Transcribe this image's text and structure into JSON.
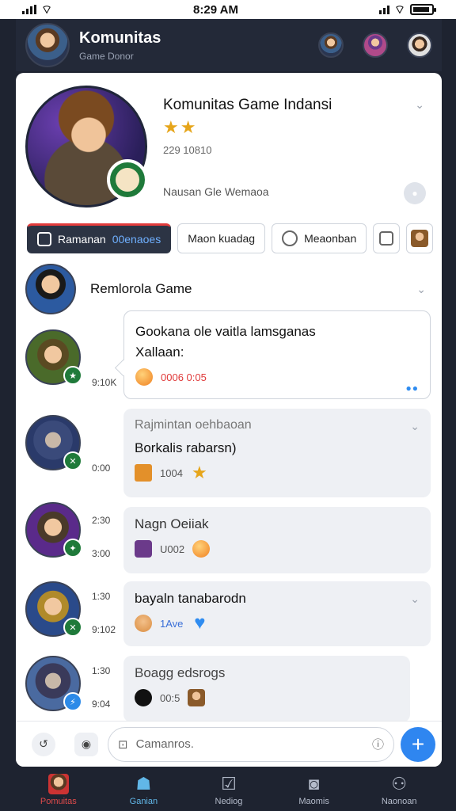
{
  "status_bar": {
    "time": "8:29 AM"
  },
  "header": {
    "title": "Komunitas",
    "subtitle": "Game Donor"
  },
  "profile": {
    "name": "Komunitas Game Indansi",
    "stars": "★★",
    "count": "229 10810",
    "status": "Nausan Gle Wemaoa"
  },
  "tabs": [
    {
      "label": "Ramanan",
      "accent": "00enaoes"
    },
    {
      "label": "Maon kuadag"
    },
    {
      "label": "Meaonban"
    }
  ],
  "section": {
    "title": "Remlorola Game"
  },
  "messages": [
    {
      "time": "9:10K",
      "text1": "Gookana ole vaitla lamsganas",
      "text2": "Xallaan:",
      "count": "0006 0:05"
    },
    {
      "time": "0:00",
      "head": "Rajmintan oehbaoan",
      "text": "Borkalis rabarsn)",
      "count": "1004"
    },
    {
      "time1": "2:30",
      "time2": "3:00",
      "head": "Nagn Oeiiak",
      "count": "U002"
    },
    {
      "time1": "1:30",
      "time2": "9:102",
      "text": "bayaln tanabarodn",
      "count": "1Ave"
    },
    {
      "time1": "1:30",
      "time2": "9:04",
      "head": "Boagg edsrogs",
      "count": "00:5"
    }
  ],
  "composer": {
    "placeholder": "Camanros."
  },
  "nav": [
    {
      "label": "Pomuitas"
    },
    {
      "label": "Ganian"
    },
    {
      "label": "Nediog"
    },
    {
      "label": "Maomis"
    },
    {
      "label": "Naonoan"
    }
  ],
  "colors": {
    "accent": "#2f86f0",
    "active_tab_bg": "#2c3444",
    "nav_active": "#e04b4b"
  }
}
